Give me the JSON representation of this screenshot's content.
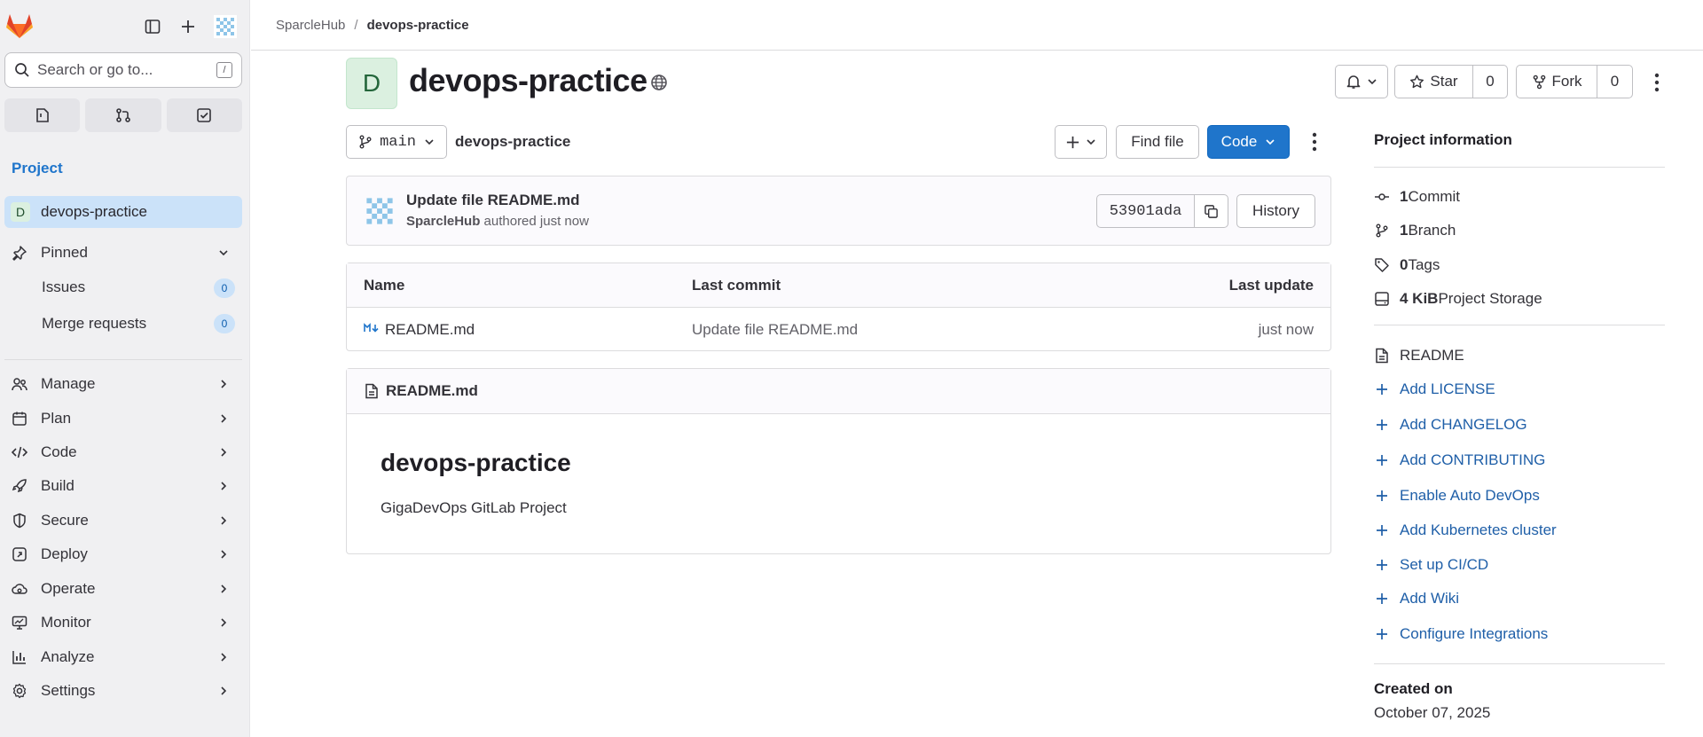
{
  "colors": {
    "accent": "#1f75cb",
    "primary_button": "#1f75cb",
    "sidebar_bg": "#f0f0f2",
    "active_item_bg": "#cbe2f9",
    "link": "#1f5fa8"
  },
  "sidebar": {
    "search_placeholder": "Search or go to...",
    "search_shortcut": "/",
    "section_title": "Project",
    "project": {
      "avatar_letter": "D",
      "name": "devops-practice"
    },
    "pinned": {
      "label": "Pinned",
      "items": [
        {
          "label": "Issues",
          "count": "0"
        },
        {
          "label": "Merge requests",
          "count": "0"
        }
      ]
    },
    "nav": [
      {
        "label": "Manage",
        "icon": "users-icon"
      },
      {
        "label": "Plan",
        "icon": "planning-icon"
      },
      {
        "label": "Code",
        "icon": "code-icon"
      },
      {
        "label": "Build",
        "icon": "rocket-icon"
      },
      {
        "label": "Secure",
        "icon": "shield-icon"
      },
      {
        "label": "Deploy",
        "icon": "deploy-icon"
      },
      {
        "label": "Operate",
        "icon": "cloud-icon"
      },
      {
        "label": "Monitor",
        "icon": "monitor-icon"
      },
      {
        "label": "Analyze",
        "icon": "chart-icon"
      },
      {
        "label": "Settings",
        "icon": "settings-icon"
      }
    ]
  },
  "breadcrumb": {
    "group": "SparcleHub",
    "separator": "/",
    "current": "devops-practice"
  },
  "project": {
    "avatar_letter": "D",
    "title": "devops-practice",
    "star_label": "Star",
    "star_count": "0",
    "fork_label": "Fork",
    "fork_count": "0"
  },
  "repo": {
    "branch": "main",
    "path": "devops-practice",
    "find_file": "Find file",
    "code_button": "Code"
  },
  "commit": {
    "title": "Update file README.md",
    "author": "SparcleHub",
    "meta_suffix": " authored just now",
    "sha": "53901ada",
    "history": "History"
  },
  "file_table": {
    "headers": [
      "Name",
      "Last commit",
      "Last update"
    ],
    "rows": [
      {
        "name": "README.md",
        "last_commit": "Update file README.md",
        "last_update": "just now"
      }
    ]
  },
  "readme": {
    "filename": "README.md",
    "heading": "devops-practice",
    "body": "GigaDevOps GitLab Project"
  },
  "info": {
    "title": "Project information",
    "stats": [
      {
        "num": "1",
        "label": " Commit"
      },
      {
        "num": "1",
        "label": " Branch"
      },
      {
        "num": "0",
        "label": " Tags"
      },
      {
        "num": "4 KiB",
        "label": " Project Storage"
      }
    ],
    "readme_link": "README",
    "add_links": [
      "Add LICENSE",
      "Add CHANGELOG",
      "Add CONTRIBUTING",
      "Enable Auto DevOps",
      "Add Kubernetes cluster",
      "Set up CI/CD",
      "Add Wiki",
      "Configure Integrations"
    ],
    "created_label": "Created on",
    "created_date": "October 07, 2025"
  }
}
